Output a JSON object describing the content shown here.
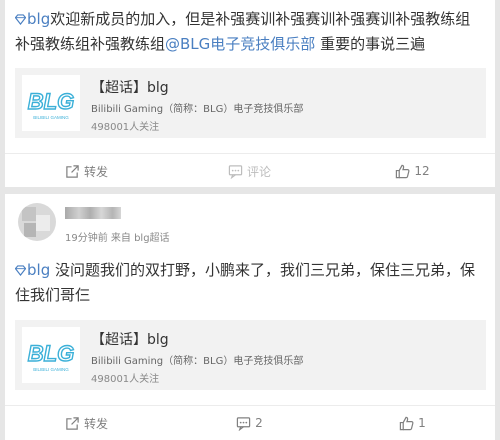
{
  "posts": [
    {
      "text_parts": {
        "topic": "blg",
        "body": "欢迎新成员的加入，但是补强赛训补强赛训补强赛训补强教练组补强教练组补强教练组",
        "mention": "@BLG电子竞技俱乐部",
        "tail": " 重要的事说三遍"
      },
      "topic_card": {
        "title": "【超话】blg",
        "description": "Bilibili Gaming（简称：BLG）电子竞技俱乐部",
        "followers": "498001人关注"
      },
      "actions": {
        "repost": "转发",
        "comment": "评论",
        "like": "12"
      }
    },
    {
      "meta": "19分钟前 来自 blg超话",
      "text_parts": {
        "topic": "blg",
        "body": " 没问题我们的双打野，小鹏来了，我们三兄弟，保住三兄弟，保住我们哥仨"
      },
      "topic_card": {
        "title": "【超话】blg",
        "description": "Bilibili Gaming（简称：BLG）电子竞技俱乐部",
        "followers": "498001人关注"
      },
      "actions": {
        "repost": "转发",
        "comment": "2",
        "like": "1"
      }
    }
  ],
  "logo_text": "BLG",
  "logo_subtext": "BILIBILI GAMING",
  "colors": {
    "link": "#4a7fc1",
    "logo": "#3bb0d8",
    "background": "#e6e6e6"
  },
  "icons": [
    "diamond-icon",
    "repost-icon",
    "comment-icon",
    "like-icon"
  ]
}
